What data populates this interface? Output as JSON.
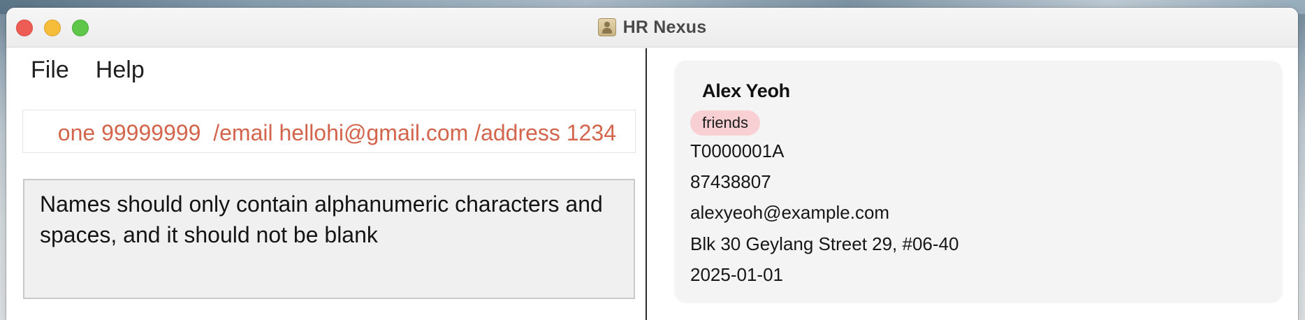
{
  "window": {
    "title": "HR Nexus",
    "app_icon": "contacts-book-icon"
  },
  "menu": {
    "items": [
      "File",
      "Help"
    ]
  },
  "command_box": {
    "value": "one 99999999  /email hellohi@gmail.com /address 1234"
  },
  "result_display": {
    "message": "Names should only contain alphanumeric characters and spaces, and it should not be blank"
  },
  "person": {
    "name": "Alex Yeoh",
    "tags": [
      "friends"
    ],
    "nric": "T0000001A",
    "phone": "87438807",
    "email": "alexyeoh@example.com",
    "address": "Blk 30 Geylang Street 29, #06-40",
    "date": "2025-01-01"
  },
  "colors": {
    "command_text": "#d2654c",
    "tag_background": "#f8cfd3",
    "close": "#ee5d55",
    "minimize": "#f6bd3b",
    "maximize": "#5ec648"
  }
}
